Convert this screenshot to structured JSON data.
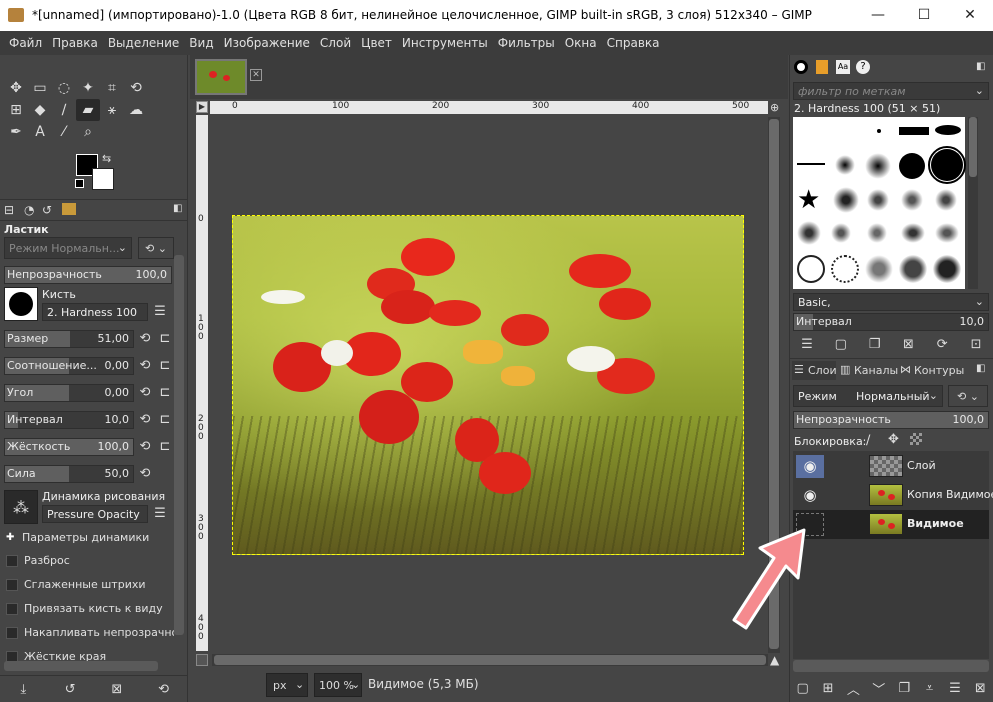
{
  "window": {
    "title": "*[unnamed] (импортировано)-1.0 (Цвета RGB 8 бит, нелинейное целочисленное, GIMP built-in sRGB, 3 слоя) 512x340 – GIMP",
    "minimize": "—",
    "maximize": "☐",
    "close": "✕"
  },
  "menu": [
    "Файл",
    "Правка",
    "Выделение",
    "Вид",
    "Изображение",
    "Слой",
    "Цвет",
    "Инструменты",
    "Фильтры",
    "Окна",
    "Справка"
  ],
  "tool_options": {
    "title": "Ластик",
    "mode": "Режим Нормальн...",
    "opacity": {
      "label": "Непрозрачность",
      "value": "100,0",
      "fraction": 1.0
    },
    "brush_label": "Кисть",
    "brush_name": "2. Hardness 100",
    "size": {
      "label": "Размер",
      "value": "51,00",
      "fraction": 0.51
    },
    "aspect": {
      "label": "Соотношение...",
      "value": "0,00",
      "fraction": 0.5
    },
    "angle": {
      "label": "Угол",
      "value": "0,00",
      "fraction": 0.5
    },
    "spacing": {
      "label": "Интервал",
      "value": "10,0",
      "fraction": 0.1
    },
    "hardness": {
      "label": "Жёсткость",
      "value": "100,0",
      "fraction": 1.0
    },
    "force": {
      "label": "Сила",
      "value": "50,0",
      "fraction": 0.5
    },
    "dynamics_label": "Динамика рисования",
    "dynamics_name": "Pressure Opacity",
    "dynamics_params": "Параметры динамики",
    "checks": [
      "Разброс",
      "Сглаженные штрихи",
      "Привязать кисть к виду",
      "Накапливать непрозрачность",
      "Жёсткие края"
    ]
  },
  "canvas": {
    "ruler_top": [
      "0",
      "100",
      "200",
      "300",
      "400",
      "500"
    ],
    "ruler_left": [
      "0",
      "1 0 0",
      "2 0 0",
      "3 0 0",
      "4 0 0"
    ],
    "unit": "px",
    "zoom": "100 %",
    "status": "Видимое (5,3 МБ)"
  },
  "brushes": {
    "filter_placeholder": "фильтр по меткам",
    "selected": "2. Hardness 100 (51 × 51)",
    "preset": "Basic,",
    "spacing_label": "Интервал",
    "spacing_value": "10,0"
  },
  "layers": {
    "tabs": [
      "Слои",
      "Каналы",
      "Контуры"
    ],
    "mode_label": "Режим",
    "mode_value": "Нормальный",
    "opacity_label": "Непрозрачность",
    "opacity_value": "100,0",
    "lock_label": "Блокировка:",
    "items": [
      {
        "name": "Слой",
        "visible": true
      },
      {
        "name": "Копия Видимое",
        "visible": true
      },
      {
        "name": "Видимое",
        "visible": false
      }
    ]
  }
}
